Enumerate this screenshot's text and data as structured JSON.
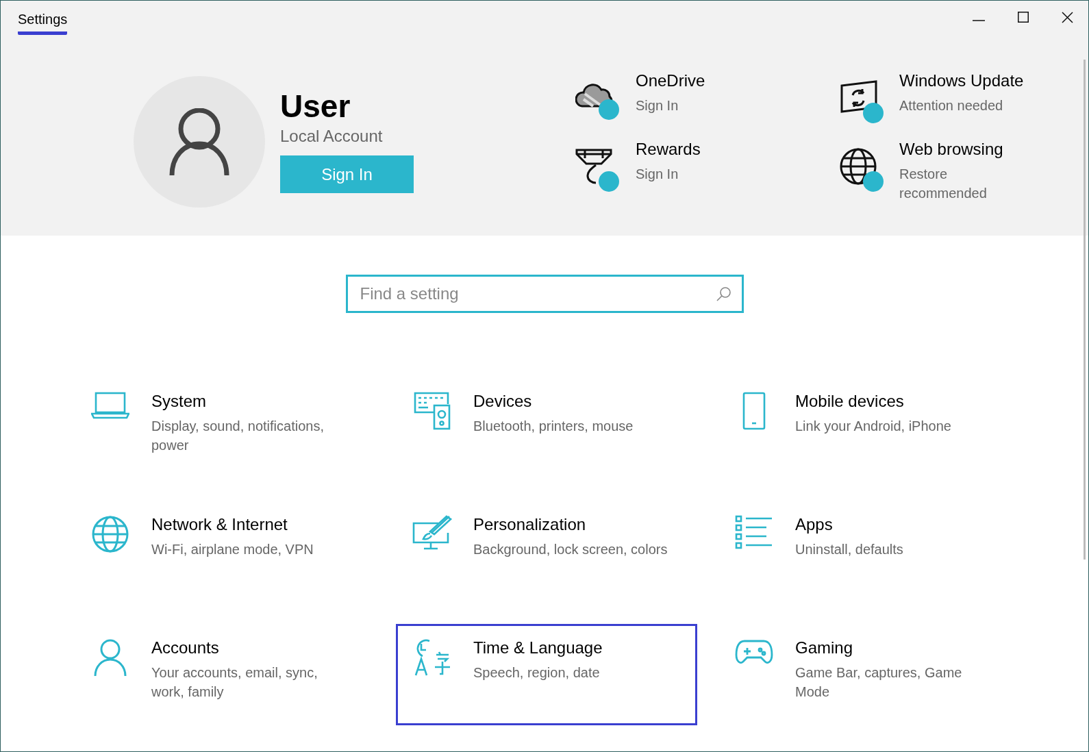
{
  "window": {
    "title": "Settings",
    "title_highlighted": true
  },
  "account": {
    "name": "User",
    "type": "Local Account",
    "button": "Sign In"
  },
  "status_items": [
    {
      "kind": "cloud",
      "title": "OneDrive",
      "status": "Sign In"
    },
    {
      "kind": "update",
      "title": "Windows Update",
      "status": "Attention needed"
    },
    {
      "kind": "medal",
      "title": "Rewards",
      "status": "Sign In"
    },
    {
      "kind": "globe",
      "title": "Web browsing",
      "status": "Restore recommended"
    }
  ],
  "search": {
    "placeholder": "Find a setting"
  },
  "categories": [
    {
      "kind": "laptop",
      "title": "System",
      "description": "Display, sound, notifications, power",
      "selected": false
    },
    {
      "kind": "devices",
      "title": "Devices",
      "description": "Bluetooth, printers, mouse",
      "selected": false
    },
    {
      "kind": "phone",
      "title": "Mobile devices",
      "description": "Link your Android, iPhone",
      "selected": false
    },
    {
      "kind": "globe",
      "title": "Network & Internet",
      "description": "Wi-Fi, airplane mode, VPN",
      "selected": false
    },
    {
      "kind": "paint",
      "title": "Personalization",
      "description": "Background, lock screen, colors",
      "selected": false
    },
    {
      "kind": "list",
      "title": "Apps",
      "description": "Uninstall, defaults",
      "selected": false
    },
    {
      "kind": "person",
      "title": "Accounts",
      "description": "Your accounts, email, sync, work, family",
      "selected": false
    },
    {
      "kind": "time",
      "title": "Time & Language",
      "description": "Speech, region, date",
      "selected": true
    },
    {
      "kind": "gamepad",
      "title": "Gaming",
      "description": "Game Bar, captures, Game Mode",
      "selected": false
    }
  ]
}
